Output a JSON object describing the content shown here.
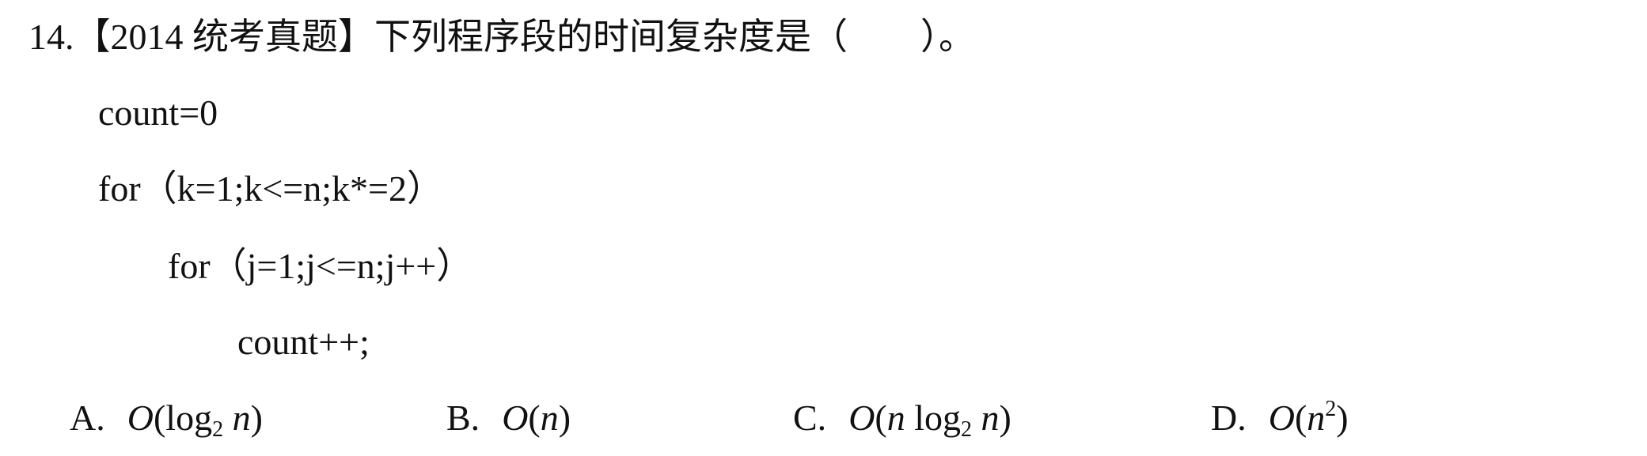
{
  "question": {
    "number": "14.",
    "source": "【2014 统考真题】",
    "text": "下列程序段的时间复杂度是（　　）。"
  },
  "code": [
    "count=0",
    "for（k=1;k<=n;k*=2）",
    "for（j=1;j<=n;j++）",
    "count++;"
  ],
  "options": [
    {
      "letter": "A.",
      "O": "O",
      "lp": "(",
      "log": "log",
      "sub": "2",
      "var": "n",
      "rp": ")"
    },
    {
      "letter": "B.",
      "O": "O",
      "lp": "(",
      "var": "n",
      "rp": ")"
    },
    {
      "letter": "C.",
      "O": "O",
      "lp": "(",
      "var1": "n",
      "log": "log",
      "sub": "2",
      "var": "n",
      "rp": ")"
    },
    {
      "letter": "D.",
      "O": "O",
      "lp": "(",
      "var": "n",
      "sup": "2",
      "rp": ")"
    }
  ]
}
